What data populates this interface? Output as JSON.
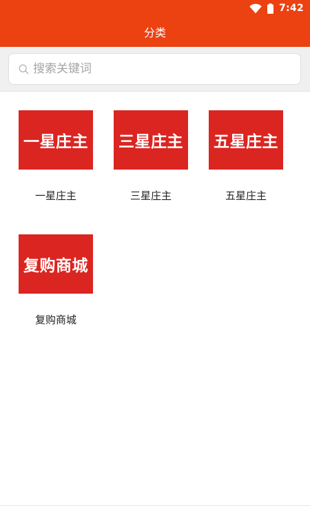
{
  "status_bar": {
    "time": "7:42",
    "wifi_icon": "wifi-icon",
    "battery_icon": "battery-icon",
    "background_color": "#ec4111"
  },
  "header": {
    "title": "分类",
    "background_color": "#ec4111"
  },
  "search": {
    "placeholder": "搜索关键词",
    "icon": "search-icon"
  },
  "categories": [
    {
      "thumb_text": "一星庄主",
      "label": "一星庄主"
    },
    {
      "thumb_text": "三星庄主",
      "label": "三星庄主"
    },
    {
      "thumb_text": "五星庄主",
      "label": "五星庄主"
    },
    {
      "thumb_text": "复购商城",
      "label": "复购商城"
    }
  ],
  "colors": {
    "accent": "#ec4111",
    "thumb_red": "#db2521"
  }
}
